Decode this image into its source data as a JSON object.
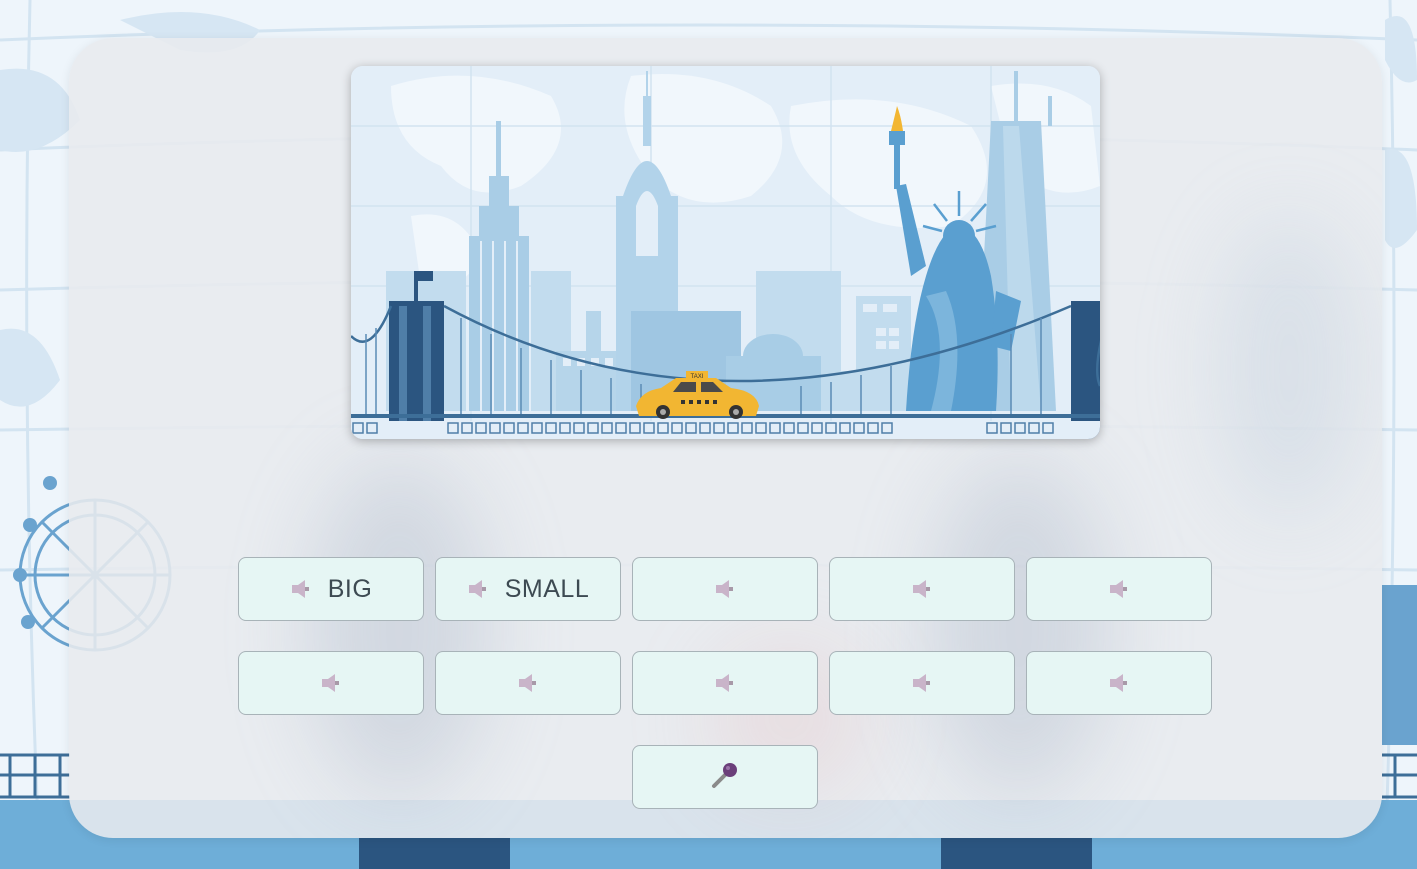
{
  "words": [
    {
      "label": "BIG",
      "icon": "speaker-icon"
    },
    {
      "label": "SMALL",
      "icon": "speaker-icon"
    },
    {
      "label": "",
      "icon": "speaker-icon"
    },
    {
      "label": "",
      "icon": "speaker-icon"
    },
    {
      "label": "",
      "icon": "speaker-icon"
    },
    {
      "label": "",
      "icon": "speaker-icon"
    },
    {
      "label": "",
      "icon": "speaker-icon"
    },
    {
      "label": "",
      "icon": "speaker-icon"
    },
    {
      "label": "",
      "icon": "speaker-icon"
    },
    {
      "label": "",
      "icon": "speaker-icon"
    }
  ],
  "microphone": {
    "icon": "microphone-icon"
  },
  "scene": {
    "taxi_sign": "TAXI",
    "colors": {
      "sky": "#e3eef8",
      "building_light": "#b9d6ea",
      "building_mid": "#8fbcdc",
      "building_dark": "#2b5580",
      "statue": "#5a9fd0",
      "taxi": "#f2b632",
      "button_bg": "#e6f6f4"
    }
  }
}
